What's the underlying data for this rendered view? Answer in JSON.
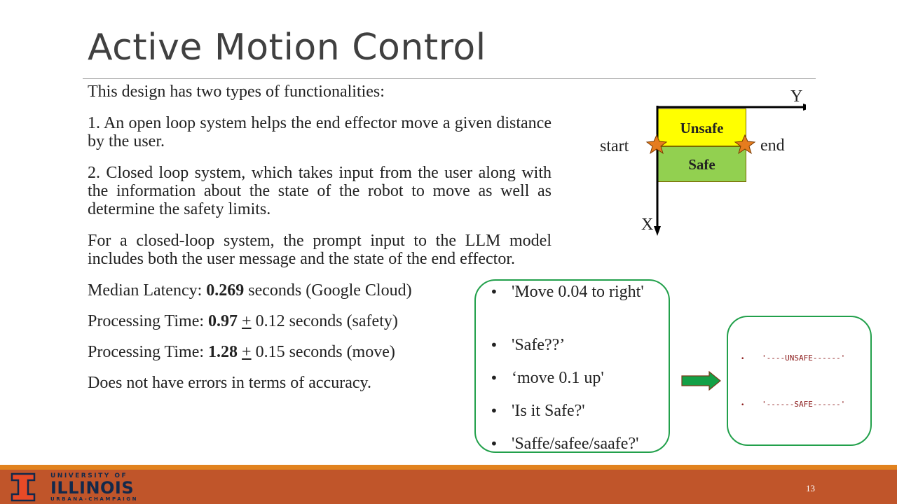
{
  "slide": {
    "title": "Active Motion Control",
    "page_number": "13"
  },
  "body": {
    "intro": "This design has two types of functionalities:",
    "point1": "1. An open loop system helps the end effector move a given distance by the user.",
    "point2": "2. Closed loop system, which takes input from the user along with the information about the state of the robot to move as well as determine the safety limits.",
    "point3": "For a closed-loop system, the prompt input to the LLM model includes both the user message and the state of the end effector.",
    "latency": {
      "prefix": "Median Latency: ",
      "value": "0.269",
      "suffix": " seconds (Google Cloud)"
    },
    "proc_safety": {
      "prefix": "Processing Time: ",
      "value": "0.97",
      "pm": "+",
      "suffix": " 0.12 seconds (safety)"
    },
    "proc_move": {
      "prefix": "Processing Time: ",
      "value": "1.28",
      "pm": "+",
      "suffix": " 0.15 seconds (move)"
    },
    "accuracy": "Does not have errors in terms of accuracy."
  },
  "diagram": {
    "axis_y": "Y",
    "axis_x": "X",
    "start_label": "start",
    "end_label": "end",
    "unsafe_label": "Unsafe",
    "safe_label": "Safe",
    "colors": {
      "unsafe": "#ffff00",
      "safe": "#92d050",
      "star": "#e57c1e"
    }
  },
  "prompts": {
    "bullet": "•",
    "items": [
      "'Move 0.04 to right'",
      "'Safe??’",
      "‘move 0.1 up'",
      "'Is it Safe?'",
      "'Saffe/safee/saafe?'"
    ]
  },
  "responses": {
    "bullet": "•",
    "items": [
      "'----UNSAFE------'",
      "'------SAFE------'"
    ]
  },
  "logo": {
    "line1": "UNIVERSITY OF",
    "line2": "ILLINOIS",
    "line3": "URBANA-CHAMPAIGN",
    "colors": {
      "orange": "#e84a27",
      "navy": "#13294b"
    }
  },
  "colors": {
    "bubble_border": "#22a04b",
    "arrow_fill": "#14a046",
    "footer": "#c0552a",
    "footer_accent": "#e1821e"
  }
}
